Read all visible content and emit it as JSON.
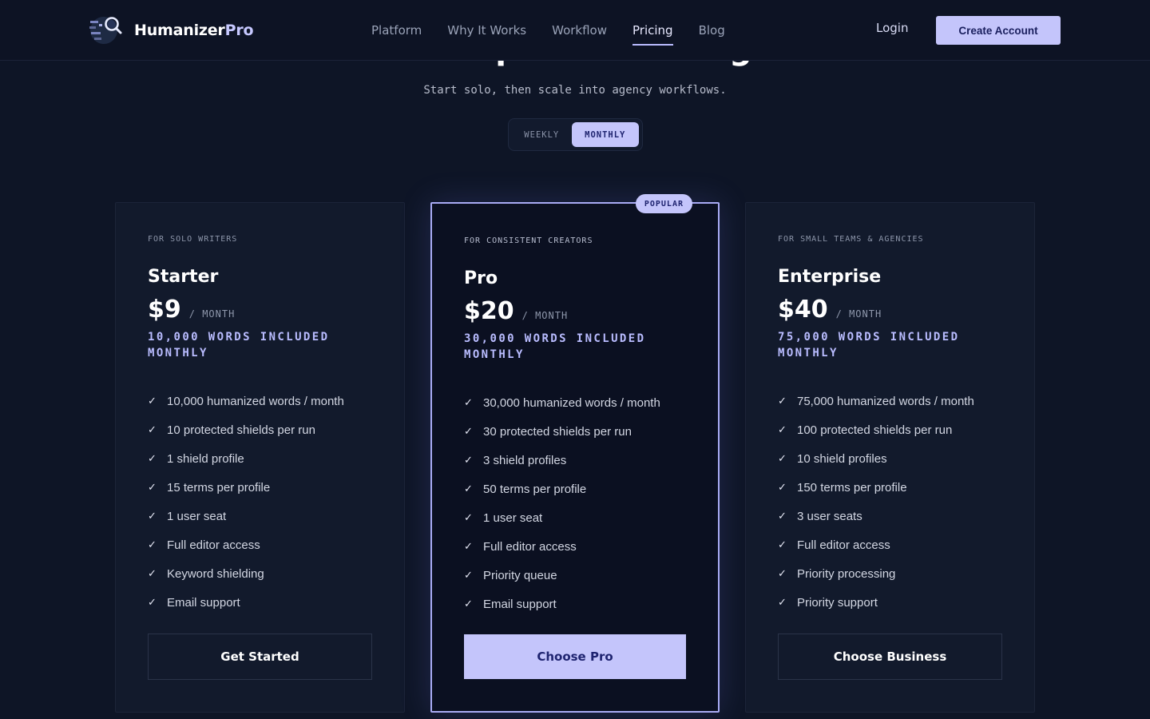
{
  "brand": {
    "name_main": "Humanizer",
    "name_accent": "Pro",
    "logo_icon": "magnifier-chip-logo"
  },
  "nav": {
    "links": [
      "Platform",
      "Why It Works",
      "Workflow",
      "Pricing",
      "Blog"
    ],
    "active": "Pricing",
    "login_label": "Login",
    "create_account_label": "Create Account"
  },
  "hero": {
    "title": "Transparent Pricing",
    "subtitle": "Start solo, then scale into agency workflows."
  },
  "billing": {
    "options": [
      "WEEKLY",
      "MONTHLY"
    ],
    "selected": "MONTHLY"
  },
  "colors": {
    "background": "#0e1526",
    "accent": "#c4c5fb",
    "accent_text": "#1f2470",
    "words_highlight": "#b9bcff"
  },
  "plans": [
    {
      "audience": "FOR SOLO WRITERS",
      "name": "Starter",
      "price": "$9",
      "period": "/ MONTH",
      "words": "10,000 WORDS INCLUDED MONTHLY",
      "features": [
        "10,000 humanized words / month",
        "10 protected shields per run",
        "1 shield profile",
        "15 terms per profile",
        "1 user seat",
        "Full editor access",
        "Keyword shielding",
        "Email support"
      ],
      "cta": "Get Started",
      "featured": false
    },
    {
      "audience": "FOR CONSISTENT CREATORS",
      "name": "Pro",
      "price": "$20",
      "period": "/ MONTH",
      "words": "30,000 WORDS INCLUDED MONTHLY",
      "badge": "POPULAR",
      "features": [
        "30,000 humanized words / month",
        "30 protected shields per run",
        "3 shield profiles",
        "50 terms per profile",
        "1 user seat",
        "Full editor access",
        "Priority queue",
        "Email support"
      ],
      "cta": "Choose Pro",
      "featured": true
    },
    {
      "audience": "FOR SMALL TEAMS & AGENCIES",
      "name": "Enterprise",
      "price": "$40",
      "period": "/ MONTH",
      "words": "75,000 WORDS INCLUDED MONTHLY",
      "features": [
        "75,000 humanized words / month",
        "100 protected shields per run",
        "10 shield profiles",
        "150 terms per profile",
        "3 user seats",
        "Full editor access",
        "Priority processing",
        "Priority support"
      ],
      "cta": "Choose Business",
      "featured": false
    }
  ]
}
